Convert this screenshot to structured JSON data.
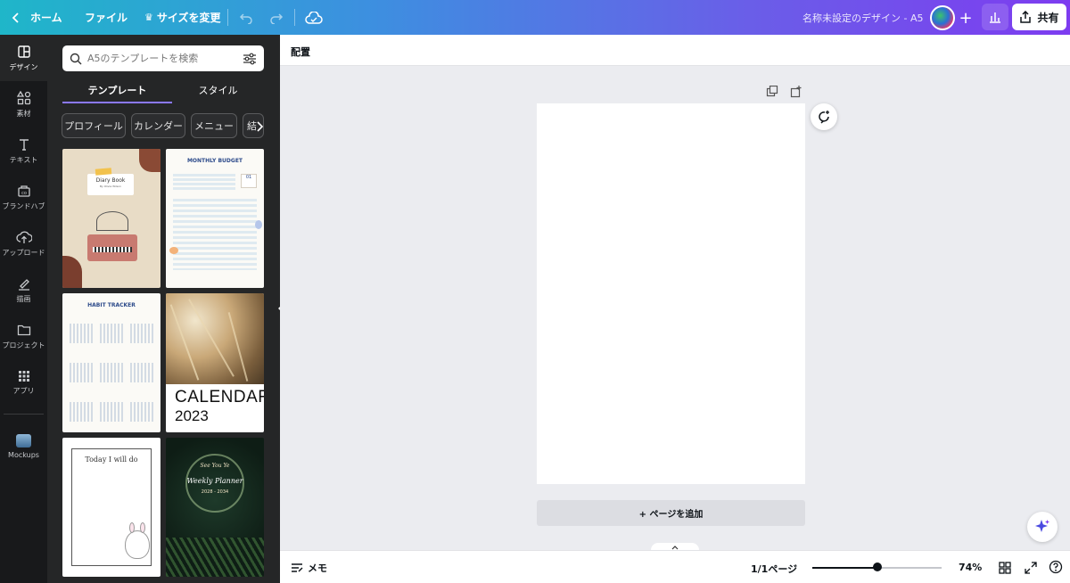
{
  "topbar": {
    "home_label": "ホーム",
    "file_label": "ファイル",
    "resize_label": "サイズを変更",
    "document_title": "名称未設定のデザイン - A5",
    "share_label": "共有"
  },
  "rail": {
    "items": [
      {
        "label": "デザイン",
        "icon": "layout-icon"
      },
      {
        "label": "素材",
        "icon": "shapes-icon"
      },
      {
        "label": "テキスト",
        "icon": "text-icon"
      },
      {
        "label": "ブランドハブ",
        "icon": "brand-icon"
      },
      {
        "label": "アップロード",
        "icon": "upload-icon"
      },
      {
        "label": "描画",
        "icon": "draw-icon"
      },
      {
        "label": "プロジェクト",
        "icon": "folder-icon"
      },
      {
        "label": "アプリ",
        "icon": "apps-icon"
      },
      {
        "label": "Mockups",
        "icon": "mockups-icon"
      }
    ]
  },
  "panel": {
    "search_placeholder": "A5のテンプレートを検索",
    "tabs": [
      "テンプレート",
      "スタイル"
    ],
    "chips": [
      "プロフィール",
      "カレンダー",
      "メニュー",
      "結"
    ],
    "templates": {
      "diary_title": "Diary Book",
      "diary_sub": "By Olivia Wilson",
      "budget_title": "MONTHLY BUDGET",
      "budget_day": "01",
      "habit_title": "HABIT TRACKER",
      "calendar_word": "CALENDAR",
      "calendar_year": "2023",
      "today_text": "Today I will do",
      "planner_top": "See You Ye",
      "planner_title": "Weekly Planner",
      "planner_years": "2028 - 2034"
    }
  },
  "canvas": {
    "context_label": "配置",
    "add_page_label": "+ ページを追加"
  },
  "bottom": {
    "notes_label": "メモ",
    "page_count": "1/1ページ",
    "zoom": "74%",
    "zoom_fraction": 0.5
  },
  "colors": {
    "accent": "#8b78ff",
    "rail_bg": "#18191b",
    "panel_bg": "#252627"
  }
}
